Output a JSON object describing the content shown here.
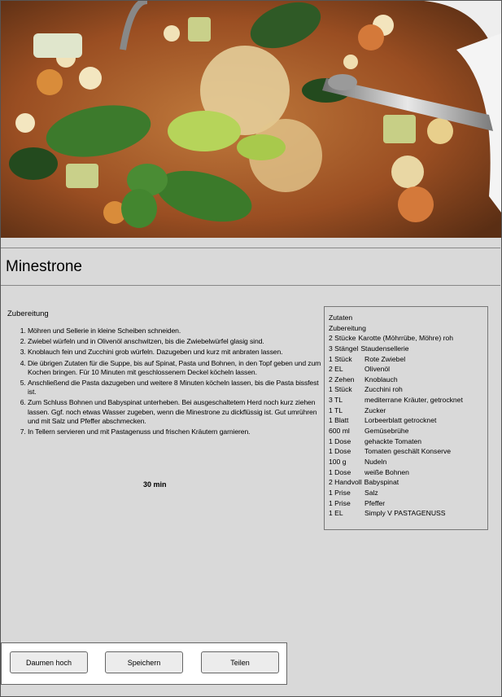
{
  "recipe": {
    "title": "Minestrone",
    "preparation_heading": "Zubereitung",
    "steps": [
      "Möhren und Sellerie in kleine Scheiben schneiden.",
      "Zwiebel würfeln und in Olivenöl anschwitzen, bis die Zwiebelwürfel glasig sind.",
      "Knoblauch fein und Zucchini grob würfeln. Dazugeben und kurz mit anbraten lassen.",
      "Die übrigen Zutaten für die Suppe, bis auf Spinat, Pasta und Bohnen, in den Topf geben und zum Kochen bringen. Für 10 Minuten mit geschlossenem Deckel köcheln lassen.",
      "Anschließend die Pasta dazugeben und weitere 8 Minuten köcheln lassen, bis die Pasta bissfest ist.",
      "Zum Schluss Bohnen und Babyspinat unterheben. Bei ausgeschaltetem Herd noch kurz ziehen lassen. Ggf. noch etwas Wasser zugeben, wenn die Minestrone zu dickflüssig ist. Gut umrühren und mit Salz und Pfeffer abschmecken.",
      "In Tellern servieren und mit Pastagenuss und frischen Kräutern garnieren."
    ],
    "duration": "30 min"
  },
  "ingredients": {
    "heading": "Zutaten",
    "subheading": "Zubereitung",
    "items": [
      {
        "amount": "2 Stücke",
        "name": "Karotte (Möhrrübe, Möhre) roh"
      },
      {
        "amount": "3 Stängel",
        "name": "Staudensellerie"
      },
      {
        "amount": "1 Stück",
        "name": "Rote Zwiebel"
      },
      {
        "amount": "2 EL",
        "name": "Olivenöl"
      },
      {
        "amount": "2 Zehen",
        "name": "Knoblauch"
      },
      {
        "amount": "1 Stück",
        "name": "Zucchini roh"
      },
      {
        "amount": "3 TL",
        "name": "mediterrane Kräuter, getrocknet"
      },
      {
        "amount": "1 TL",
        "name": "Zucker"
      },
      {
        "amount": "1 Blatt",
        "name": "Lorbeerblatt getrocknet"
      },
      {
        "amount": "600 ml",
        "name": "Gemüsebrühe"
      },
      {
        "amount": "1 Dose",
        "name": "gehackte Tomaten"
      },
      {
        "amount": "1 Dose",
        "name": "Tomaten geschält Konserve"
      },
      {
        "amount": "100 g",
        "name": "Nudeln"
      },
      {
        "amount": "1 Dose",
        "name": "weiße Bohnen"
      },
      {
        "amount": "2 Handvoll",
        "name": "Babyspinat"
      },
      {
        "amount": "1 Prise",
        "name": "Salz"
      },
      {
        "amount": "1 Prise",
        "name": "Pfeffer"
      },
      {
        "amount": "1 EL",
        "name": "Simply V PASTAGENUSS"
      }
    ]
  },
  "actions": {
    "like_label": "Daumen hoch",
    "save_label": "Speichern",
    "share_label": "Teilen"
  }
}
